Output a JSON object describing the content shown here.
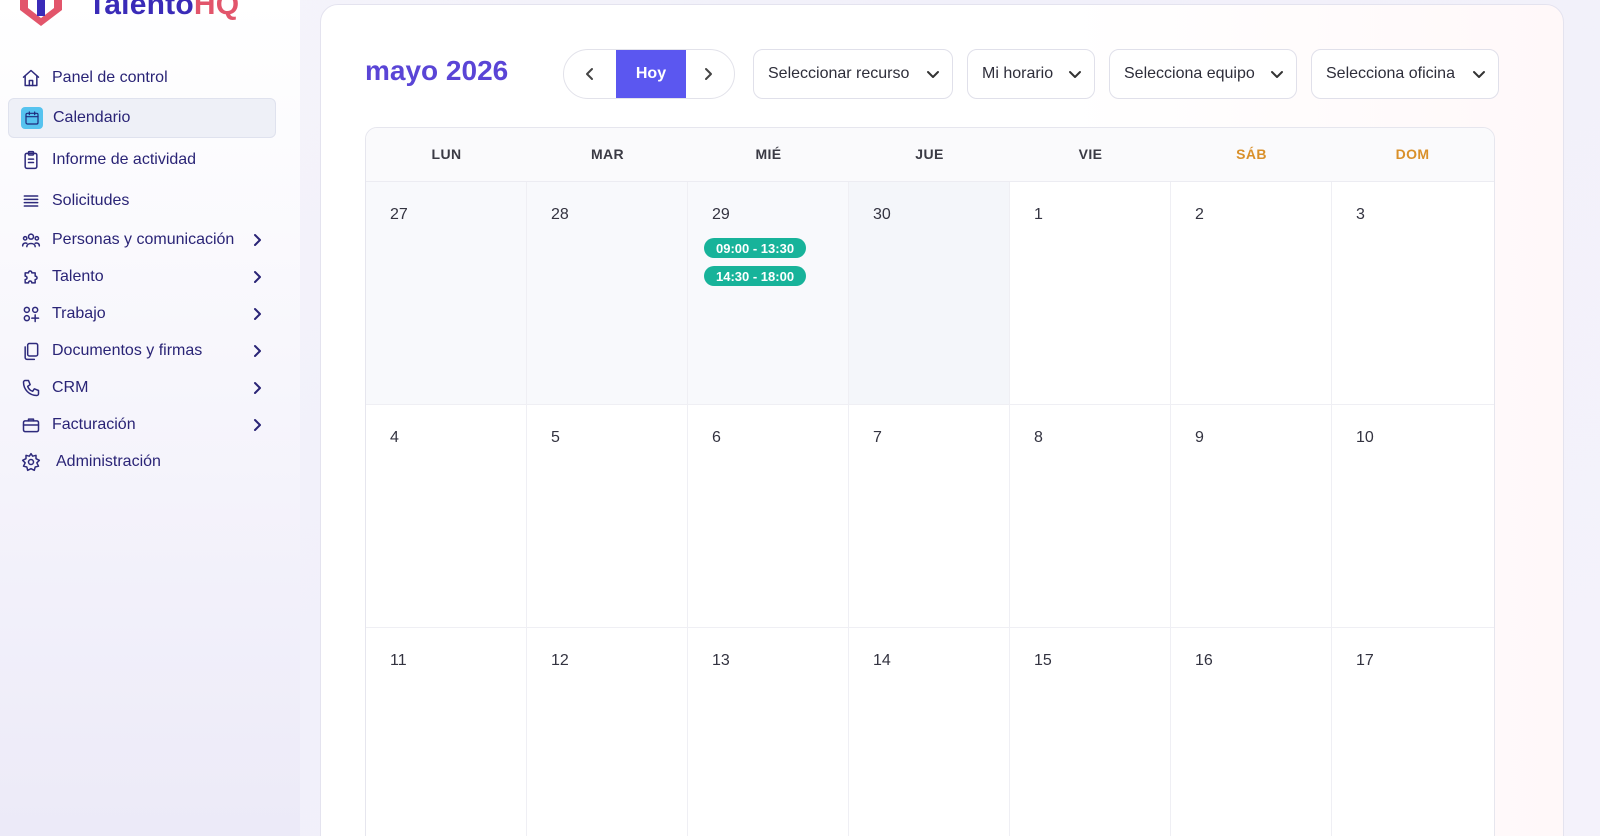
{
  "brand": {
    "name_part1": "Talento",
    "name_part2": "HQ",
    "colors": {
      "primary": "#3a2bb8",
      "accent": "#e2556b"
    }
  },
  "sidebar": {
    "items": [
      {
        "label": "Panel de control",
        "icon": "home-icon",
        "has_children": false
      },
      {
        "label": "Calendario",
        "icon": "calendar-icon",
        "has_children": false,
        "active": true
      },
      {
        "label": "Informe de actividad",
        "icon": "clipboard-icon",
        "has_children": false
      },
      {
        "label": "Solicitudes",
        "icon": "list-icon",
        "has_children": false
      },
      {
        "label": "Personas y comunicación",
        "icon": "users-icon",
        "has_children": true
      },
      {
        "label": "Talento",
        "icon": "puzzle-icon",
        "has_children": true
      },
      {
        "label": "Trabajo",
        "icon": "apps-icon",
        "has_children": true
      },
      {
        "label": "Documentos y firmas",
        "icon": "documents-icon",
        "has_children": true
      },
      {
        "label": "CRM",
        "icon": "phone-icon",
        "has_children": true
      },
      {
        "label": "Facturación",
        "icon": "briefcase-icon",
        "has_children": true
      },
      {
        "label": "Administración",
        "icon": "gear-icon",
        "has_children": false
      }
    ]
  },
  "toolbar": {
    "month_title": "mayo 2026",
    "today_label": "Hoy",
    "filters": [
      {
        "label": "Seleccionar recurso"
      },
      {
        "label": "Mi horario"
      },
      {
        "label": "Selecciona equipo"
      },
      {
        "label": "Selecciona oficina"
      }
    ],
    "today_color": "#5b57f0"
  },
  "calendar": {
    "weekdays": [
      "LUN",
      "MAR",
      "MIÉ",
      "JUE",
      "VIE",
      "SÁB",
      "DOM"
    ],
    "weekend_color": "#d9902a",
    "event_color": "#17b39a",
    "weeks": [
      [
        {
          "day": "27",
          "past": true
        },
        {
          "day": "28",
          "past": true
        },
        {
          "day": "29",
          "past": true,
          "events": [
            "09:00 - 13:30",
            "14:30 - 18:00"
          ]
        },
        {
          "day": "30",
          "today": true
        },
        {
          "day": "1"
        },
        {
          "day": "2"
        },
        {
          "day": "3"
        }
      ],
      [
        {
          "day": "4"
        },
        {
          "day": "5"
        },
        {
          "day": "6"
        },
        {
          "day": "7"
        },
        {
          "day": "8"
        },
        {
          "day": "9"
        },
        {
          "day": "10"
        }
      ],
      [
        {
          "day": "11"
        },
        {
          "day": "12"
        },
        {
          "day": "13"
        },
        {
          "day": "14"
        },
        {
          "day": "15"
        },
        {
          "day": "16"
        },
        {
          "day": "17"
        }
      ]
    ]
  }
}
